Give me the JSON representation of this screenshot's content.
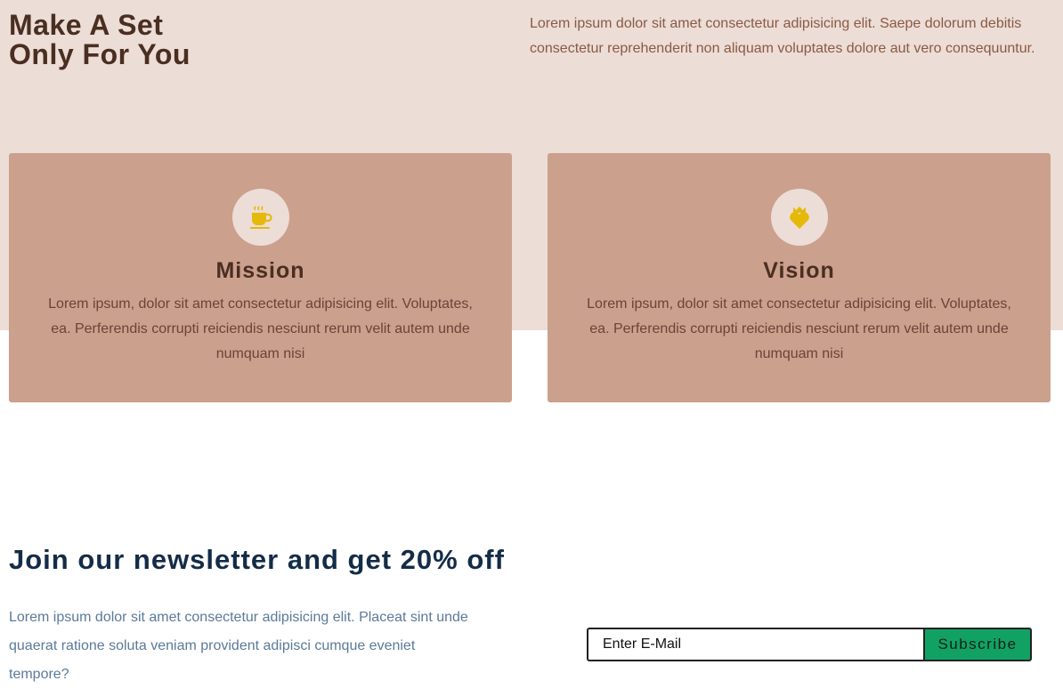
{
  "hero": {
    "title_line1": "Make A Set",
    "title_line2": "Only For You",
    "description": "Lorem ipsum dolor sit amet consectetur adipisicing elit. Saepe dolorum debitis consectetur reprehenderit non aliquam voluptates dolore aut vero consequuntur."
  },
  "cards": [
    {
      "icon": "coffee-cup-icon",
      "title": "Mission",
      "text": "Lorem ipsum, dolor sit amet consectetur adipisicing elit. Voluptates, ea. Perferendis corrupti reiciendis nesciunt rerum velit autem unde numquam nisi"
    },
    {
      "icon": "crowned-heart-icon",
      "title": "Vision",
      "text": "Lorem ipsum, dolor sit amet consectetur adipisicing elit. Voluptates, ea. Perferendis corrupti reiciendis nesciunt rerum velit autem unde numquam nisi"
    }
  ],
  "newsletter": {
    "title": "Join our newsletter and get 20% off",
    "text": "Lorem ipsum dolor sit amet consectetur adipisicing elit. Placeat sint unde quaerat ratione soluta veniam provident adipisci cumque eveniet tempore?",
    "email_placeholder": "Enter E-Mail",
    "subscribe_label": "Subscribe"
  },
  "colors": {
    "hero_bg": "#ecddd6",
    "card_bg": "#cba08d",
    "heading_brown": "#4a2e22",
    "icon_gold": "#e5b90a",
    "newsletter_title": "#142c47",
    "subscribe_green": "#11a263"
  }
}
